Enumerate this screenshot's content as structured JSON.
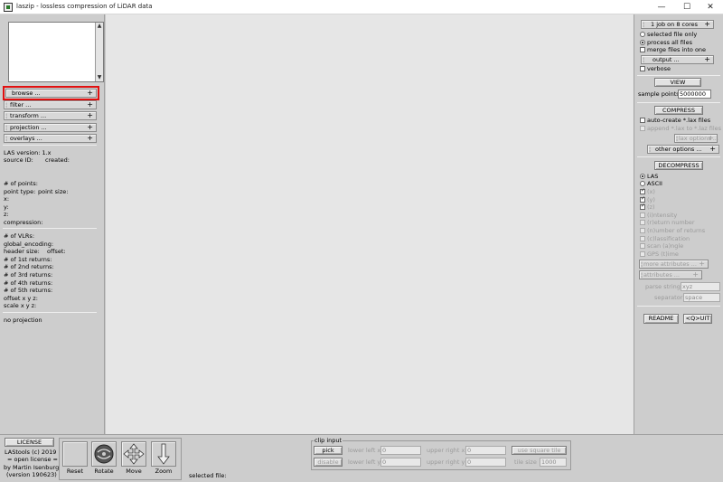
{
  "window": {
    "title": "laszip - lossless compression of LiDAR data",
    "minimize": "—",
    "maximize": "☐",
    "close": "✕"
  },
  "left": {
    "menus": {
      "browse": "browse ...",
      "filter": "filter ...",
      "transform": "transform ...",
      "projection": "projection ...",
      "overlays": "overlays ..."
    },
    "info": {
      "las_version": "LAS version: 1.x",
      "source_id": "source ID:",
      "created": "created:",
      "num_points": "# of points:",
      "point_type": "point type:",
      "point_size": "point size:",
      "x": "x:",
      "y": "y:",
      "z": "z:",
      "compression": "compression:",
      "num_vlrs": "# of VLRs:",
      "global_encoding": "global_encoding:",
      "header_size": "header size:",
      "offset": "offset:",
      "returns1": "# of 1st returns:",
      "returns2": "# of 2nd returns:",
      "returns3": "# of 3rd returns:",
      "returns4": "# of 4th returns:",
      "returns5": "# of 5th returns:",
      "offset_xyz": "offset x y z:",
      "scale_xyz": "scale x y z:",
      "projection": "no projection"
    }
  },
  "right": {
    "cores": "1 job on 8 cores",
    "selected_file_only": "selected file only",
    "process_all_files": "process all files",
    "merge_files": "merge files into one",
    "output": "output ...",
    "verbose": "verbose",
    "view": "VIEW",
    "sample_points_label": "sample points",
    "sample_points_value": "5000000",
    "compress": "COMPRESS",
    "auto_create_lax": "auto-create *.lax files",
    "append_lax": "append *.lax to *.laz files",
    "lax_options": "lax options ...",
    "other_options": "other options ...",
    "decompress": "DECOMPRESS",
    "las": "LAS",
    "ascii": "ASCII",
    "x": "(x)",
    "y": "(y)",
    "z": "(z)",
    "intensity": "(i)ntensity",
    "return_number": "(r)eturn number",
    "number_of_returns": "(n)umber of returns",
    "classification": "(c)lassification",
    "scan_angle": "scan (a)ngle",
    "gps_time": "GPS (t)ime",
    "more_attributes": "more attributes ...",
    "attributes": "attributes ...",
    "parse_string_label": "parse string",
    "parse_string_value": "xyz",
    "separator_label": "separator",
    "separator_value": "space",
    "readme": "README",
    "quit": "<Q>UIT"
  },
  "bottom": {
    "license": "LICENSE",
    "copyright1": "LAStools (c) 2019",
    "copyright2": "= open license =",
    "copyright3": "by Martin Isenburg",
    "copyright4": "(version 190623)",
    "reset": "Reset",
    "rotate": "Rotate",
    "move": "Move",
    "zoom": "Zoom",
    "selected_file": "selected file:",
    "clip_input": "clip input",
    "pick": "pick",
    "disable": "disable",
    "lower_left_x": "lower left x",
    "lower_left_y": "lower left y",
    "upper_right_x": "upper right x",
    "upper_right_y": "upper right y",
    "llx_value": "0",
    "lly_value": "0",
    "urx_value": "0",
    "ury_value": "0",
    "use_square_tile": "use square tile",
    "tile_size": "tile size",
    "tile_size_value": "1000"
  }
}
